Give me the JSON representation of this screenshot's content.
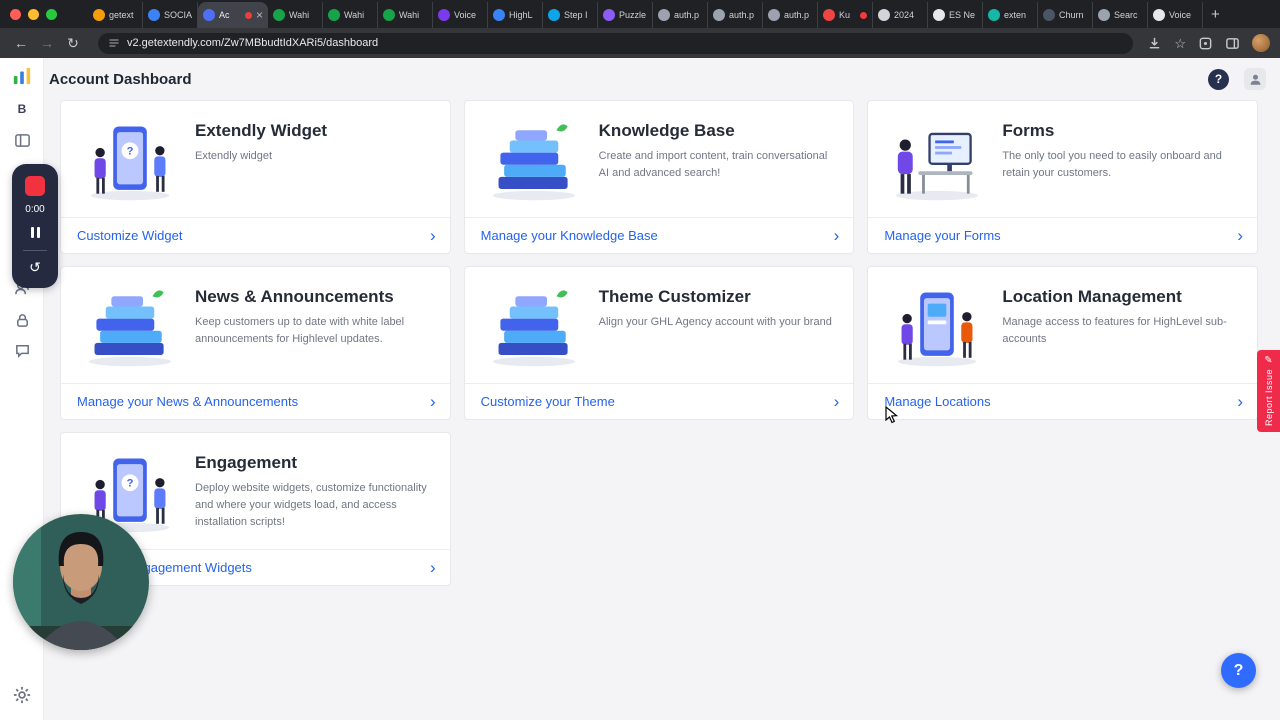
{
  "browser": {
    "tabs": [
      {
        "label": "getext",
        "color": "#f59e0b"
      },
      {
        "label": "SOCIA",
        "color": "#3b82f6"
      },
      {
        "label": "Ac",
        "color": "#4f6ef7",
        "recording": true
      },
      {
        "label": "Wahi",
        "color": "#16a34a"
      },
      {
        "label": "Wahi",
        "color": "#16a34a"
      },
      {
        "label": "Wahi",
        "color": "#16a34a"
      },
      {
        "label": "Voice",
        "color": "#7c3aed"
      },
      {
        "label": "HighL",
        "color": "#3b82f6"
      },
      {
        "label": "Step I",
        "color": "#0ea5e9"
      },
      {
        "label": "Puzzle",
        "color": "#8b5cf6"
      },
      {
        "label": "auth.p",
        "color": "#9ca3af"
      },
      {
        "label": "auth.p",
        "color": "#9ca3af"
      },
      {
        "label": "auth.p",
        "color": "#9ca3af"
      },
      {
        "label": "Ku",
        "color": "#ef4444",
        "recording": true
      },
      {
        "label": "2024",
        "color": "#d1d5db"
      },
      {
        "label": "ES Ne",
        "color": "#e5e7eb"
      },
      {
        "label": "exten",
        "color": "#14b8a6"
      },
      {
        "label": "Churn",
        "color": "#4b5563"
      },
      {
        "label": "Searc",
        "color": "#9ca3af"
      },
      {
        "label": "Voice",
        "color": "#e5e7eb"
      }
    ],
    "active_tab_index": 2,
    "url": "v2.getextendly.com/Zw7MBbudtIdXARi5/dashboard"
  },
  "header": {
    "title": "Account Dashboard"
  },
  "sidebar": {
    "badge": "B",
    "recorder_time": "0:00"
  },
  "cards": [
    {
      "title": "Extendly Widget",
      "description": "Extendly widget",
      "action": "Customize Widget"
    },
    {
      "title": "Knowledge Base",
      "description": "Create and import content, train conversational AI and advanced search!",
      "action": "Manage your Knowledge Base"
    },
    {
      "title": "Forms",
      "description": "The only tool you need to easily onboard and retain your customers.",
      "action": "Manage your Forms"
    },
    {
      "title": "News & Announcements",
      "description": "Keep customers up to date with white label announcements for Highlevel updates.",
      "action": "Manage your News & Announcements"
    },
    {
      "title": "Theme Customizer",
      "description": "Align your GHL Agency account with your brand",
      "action": "Customize your Theme"
    },
    {
      "title": "Location Management",
      "description": "Manage access to features for HighLevel sub-accounts",
      "action": "Manage Locations"
    },
    {
      "title": "Engagement",
      "description": "Deploy website widgets, customize functionality and where your widgets load, and access installation scripts!",
      "action": "Manage Engagement Widgets"
    }
  ],
  "report_issue_label": "Report Issue",
  "icons": {
    "back": "←",
    "forward": "→",
    "reload": "↻",
    "new_tab": "+",
    "close": "×",
    "star": "☆",
    "chevron": "›",
    "question": "?",
    "pencil": "✎",
    "restart": "↺"
  },
  "colors": {
    "accent": "#2563eb",
    "report": "#ee2b4b",
    "record": "#f2333f",
    "fab": "#2f6bff"
  }
}
